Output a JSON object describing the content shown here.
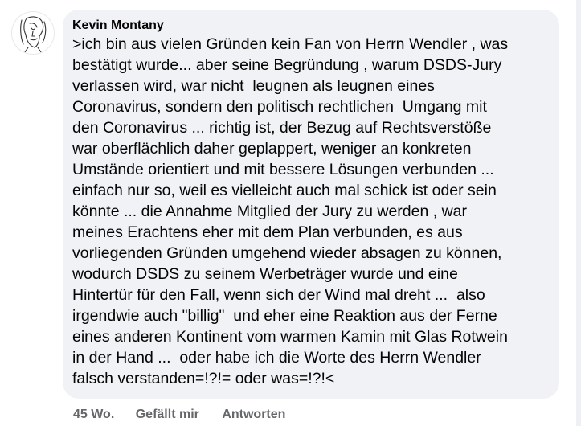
{
  "comment": {
    "author": "Kevin Montany",
    "avatar_icon": "sketch-face-avatar",
    "lines": [
      ">ich bin aus vielen Gründen kein Fan von Herrn Wendler , was",
      "bestätigt wurde... aber seine Begründung , warum DSDS-Jury",
      "verlassen wird, war nicht  leugnen als leugnen eines",
      "Coronavirus, sondern den politisch rechtlichen  Umgang mit",
      "den Coronavirus ... richtig ist, der Bezug auf Rechtsverstöße",
      "war oberflächlich daher geplappert, weniger an konkreten",
      "Umstände orientiert und mit bessere Lösungen verbunden ...",
      "einfach nur so, weil es vielleicht auch mal schick ist oder sein",
      "könnte ... die Annahme Mitglied der Jury zu werden , war",
      "meines Erachtens eher mit dem Plan verbunden, es aus",
      "vorliegenden Gründen umgehend wieder absagen zu können,",
      "wodurch DSDS zu seinem Werbeträger wurde und eine",
      "Hintertür für den Fall, wenn sich der Wind mal dreht ...  also",
      "irgendwie auch \"billig\"  und eher eine Reaktion aus der Ferne",
      "eines anderen Kontinent vom warmen Kamin mit Glas Rotwein",
      "in der Hand ...  oder habe ich die Worte des Herrn Wendler",
      "falsch verstanden=!?!= oder was=!?!<"
    ]
  },
  "actions": {
    "time": "45 Wo.",
    "like": "Gefällt mir",
    "reply": "Antworten"
  },
  "colors": {
    "bubble_bg": "#f0f2f5",
    "text": "#050505",
    "meta": "#65676b"
  }
}
